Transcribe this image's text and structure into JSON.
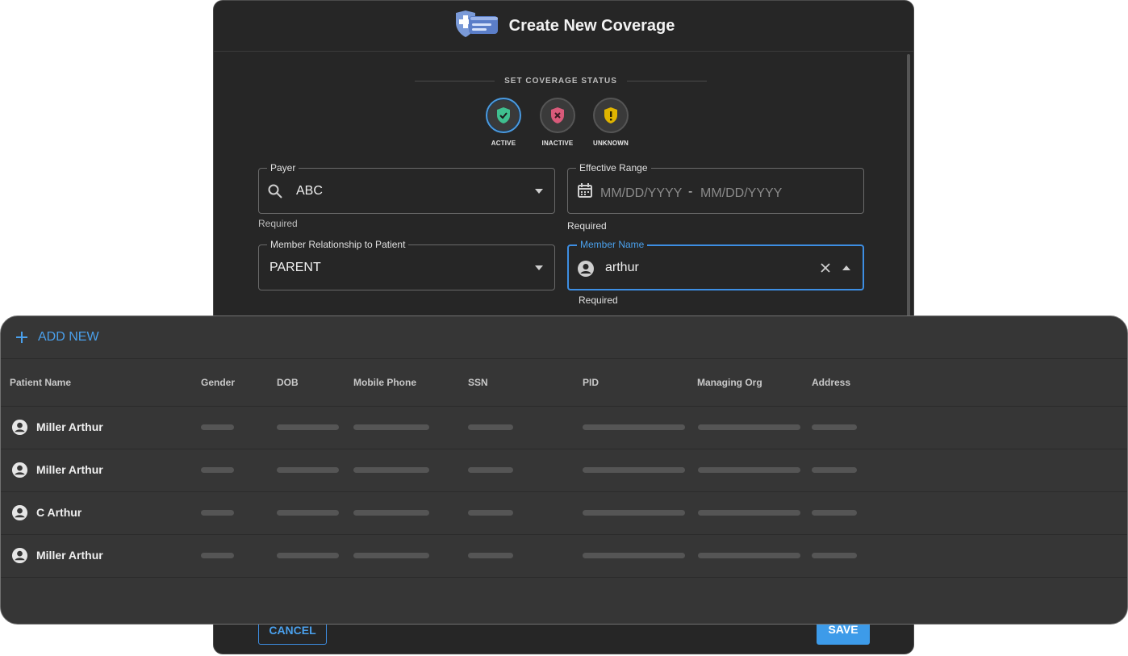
{
  "dialog": {
    "title": "Create New Coverage",
    "status_heading": "SET COVERAGE STATUS",
    "statuses": [
      {
        "label": "ACTIVE",
        "color": "#3fbf8f",
        "selected": true
      },
      {
        "label": "INACTIVE",
        "color": "#d95a7a",
        "selected": false
      },
      {
        "label": "UNKNOWN",
        "color": "#e0b400",
        "selected": false
      }
    ],
    "payer": {
      "label": "Payer",
      "value": "ABC",
      "helper": "Required"
    },
    "effective_range": {
      "label": "Effective Range",
      "start_placeholder": "MM/DD/YYYY",
      "separator": "-",
      "end_placeholder": "MM/DD/YYYY",
      "helper": "Required"
    },
    "relationship": {
      "label": "Member Relationship to Patient",
      "value": "PARENT"
    },
    "member_name": {
      "label": "Member Name",
      "value": "arthur",
      "helper": "Required"
    },
    "cancel_label": "CANCEL",
    "save_label": "SAVE"
  },
  "dropdown": {
    "add_new_label": "ADD NEW",
    "columns": [
      "Patient Name",
      "Gender",
      "DOB",
      "Mobile Phone",
      "SSN",
      "PID",
      "Managing Org",
      "Address"
    ],
    "rows": [
      {
        "name": "Miller Arthur"
      },
      {
        "name": "Miller Arthur"
      },
      {
        "name": "C Arthur"
      },
      {
        "name": "Miller Arthur"
      }
    ]
  },
  "colors": {
    "accent": "#3d8ee3",
    "background": "#262626",
    "panel": "#363636",
    "save_button": "#3d9be9"
  }
}
